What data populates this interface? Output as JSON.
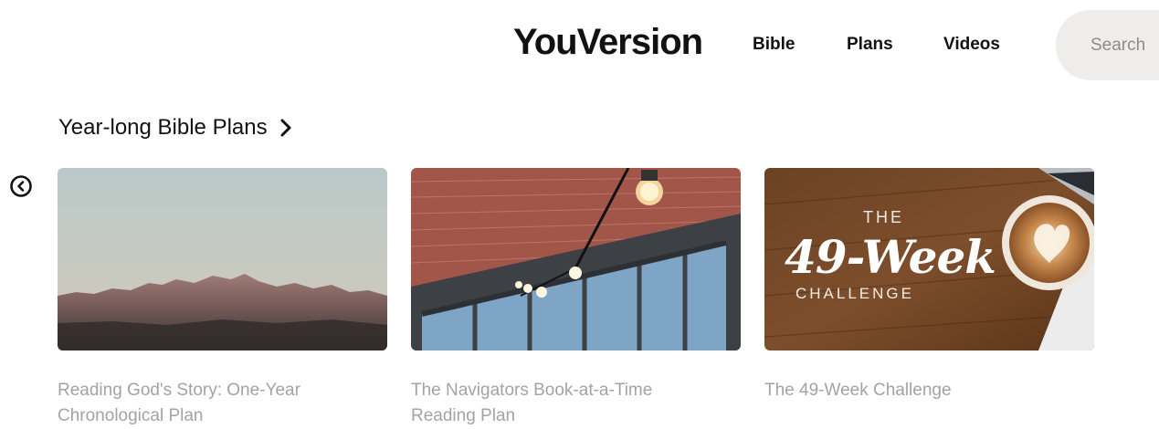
{
  "header": {
    "logo": "YouVersion",
    "nav": [
      {
        "label": "Bible"
      },
      {
        "label": "Plans"
      },
      {
        "label": "Videos"
      }
    ],
    "search": {
      "placeholder": "Search"
    }
  },
  "section": {
    "title": "Year-long Bible Plans"
  },
  "cards": [
    {
      "title": "Reading God's Story: One-Year Chronological Plan",
      "image": "mountain-range-at-dusk"
    },
    {
      "title": "The Navigators Book-at-a-Time Reading Plan",
      "image": "brick-building-with-string-lights"
    },
    {
      "title": "The 49-Week Challenge",
      "image": "coffee-on-wood-table",
      "image_text": {
        "top": "THE",
        "main": "49-Week",
        "bottom": "CHALLENGE"
      }
    }
  ],
  "icons": {
    "section_arrow": "chevron-right-icon",
    "carousel_prev": "circle-chevron-left-icon"
  },
  "colors": {
    "text": "#121212",
    "muted_text": "#a3a3a3",
    "search_bg": "#eeedec"
  }
}
